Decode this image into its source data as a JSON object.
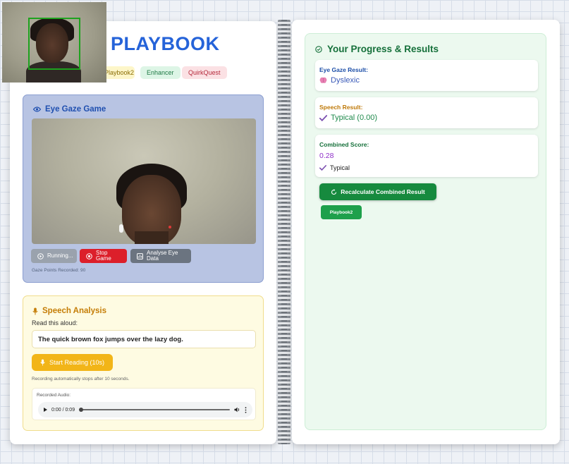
{
  "header": {
    "title": "PLAYBOOK",
    "nav": [
      {
        "label": "Playbook2"
      },
      {
        "label": "Enhancer"
      },
      {
        "label": "QuirkQuest"
      }
    ]
  },
  "eye_gaze": {
    "title": "Eye Gaze Game",
    "buttons": {
      "running": "Running...",
      "stop": "Stop Game",
      "analyse": "Analyse Eye Data"
    },
    "gaze_points": "Gaze Points Recorded: 90"
  },
  "speech": {
    "title": "Speech Analysis",
    "instruction": "Read this aloud:",
    "sentence": "The quick brown fox jumps over the lazy dog.",
    "start_button": "Start Reading (10s)",
    "note": "Recording automatically stops after 10 seconds.",
    "audio_label": "Recorded Audio:",
    "audio_time": "0:00 / 0:09"
  },
  "results": {
    "title": "Your Progress & Results",
    "gaze_label": "Eye Gaze Result:",
    "gaze_value": "Dyslexic",
    "speech_label": "Speech Result:",
    "speech_value": "Typical (0.00)",
    "combined_label": "Combined Score:",
    "combined_score": "0.28",
    "combined_class": "Typical",
    "recalc_button": "Recalculate Combined Result",
    "playbook2_button": "Playbook2"
  },
  "colors": {
    "accent_blue": "#2563d9",
    "stop_red": "#dc1f2a",
    "start_yellow": "#f2b518",
    "success_green": "#168a3e",
    "score_purple": "#8e2fc8"
  }
}
